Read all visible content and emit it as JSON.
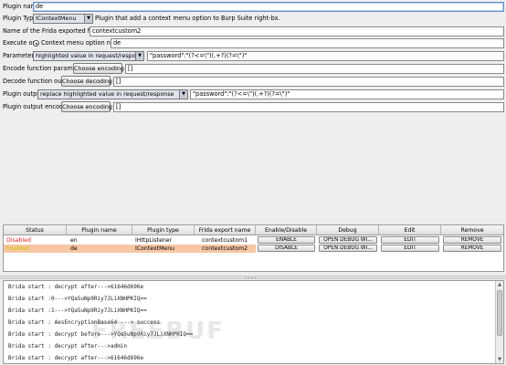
{
  "form": {
    "plugin_name_label": "Plugin name:",
    "plugin_name_value": "de",
    "plugin_type_label": "Plugin Type",
    "plugin_type_value": "IContextMenu",
    "plugin_type_desc": "Plugin that add a context menu option to Burp Suite right-bx.",
    "frida_fn_label": "Name of the Frida exported function:",
    "frida_fn_value": "contextcustom2",
    "execute_on_label": "Execute on:",
    "execute_on_option": "Context menu option named:",
    "execute_on_value": "de",
    "parameters_label": "Parameters:",
    "parameters_value": "highlighted value in request/response",
    "parameters_regex": "\"password\":\"(?<=\\\")(.+?)(?=\\\")\"",
    "encode_label": "Encode function parameters:",
    "encode_button": "Choose encoding",
    "encode_value": "[]",
    "decode_label": "Decode function output:",
    "decode_button": "Choose decoding",
    "decode_value": "[]",
    "output_label": "Plugin output:",
    "output_value": "replace highlighted value in request/response",
    "output_regex": "\"password\":\"(?<=\\\")(.+?)(?=\\\")\"",
    "output_enc_label": "Plugin output encoding:",
    "output_enc_button": "Choose encoding",
    "output_enc_value": "[]"
  },
  "table": {
    "headers": [
      "Status",
      "Plugin name",
      "Plugin type",
      "Frida export name",
      "Enable/Disable",
      "Debug",
      "Edit",
      "Remove"
    ],
    "rows": [
      {
        "status": "Disabled",
        "name": "en",
        "type": "IHttpListener",
        "export": "contextcustom1",
        "toggle": "ENABLE",
        "debug": "OPEN DEBUG WI...",
        "edit": "EDIT",
        "remove": "REMOVE"
      },
      {
        "status": "Enabled",
        "name": "de",
        "type": "IContextMenu",
        "export": "contextcustom2",
        "toggle": "DISABLE",
        "debug": "OPEN DEBUG WI...",
        "edit": "EDIT",
        "remove": "REMOVE"
      }
    ]
  },
  "console": {
    "lines": [
      "Brida start : decrypt after--->61646d696e",
      "Brida start :0--->YQa5uNp9Riy7JLiXNHPKIQ==",
      "Brida start :1--->YQa5uNp9Riy7JLiXNHPKIQ==",
      "Brida start : AesEncryptionBase64 ---> success",
      "Brida start : decrypt before--->YQa5uNp9Riy7JLiXNHPKIQ==",
      "Brida start : decrypt after--->admin",
      "Brida start : decrypt after--->61646d696e"
    ]
  },
  "watermark": "FREEBUF",
  "colors": {
    "disabled": "#e02020",
    "enabled": "#c8c800",
    "selected_row": "#f7c6a4"
  }
}
